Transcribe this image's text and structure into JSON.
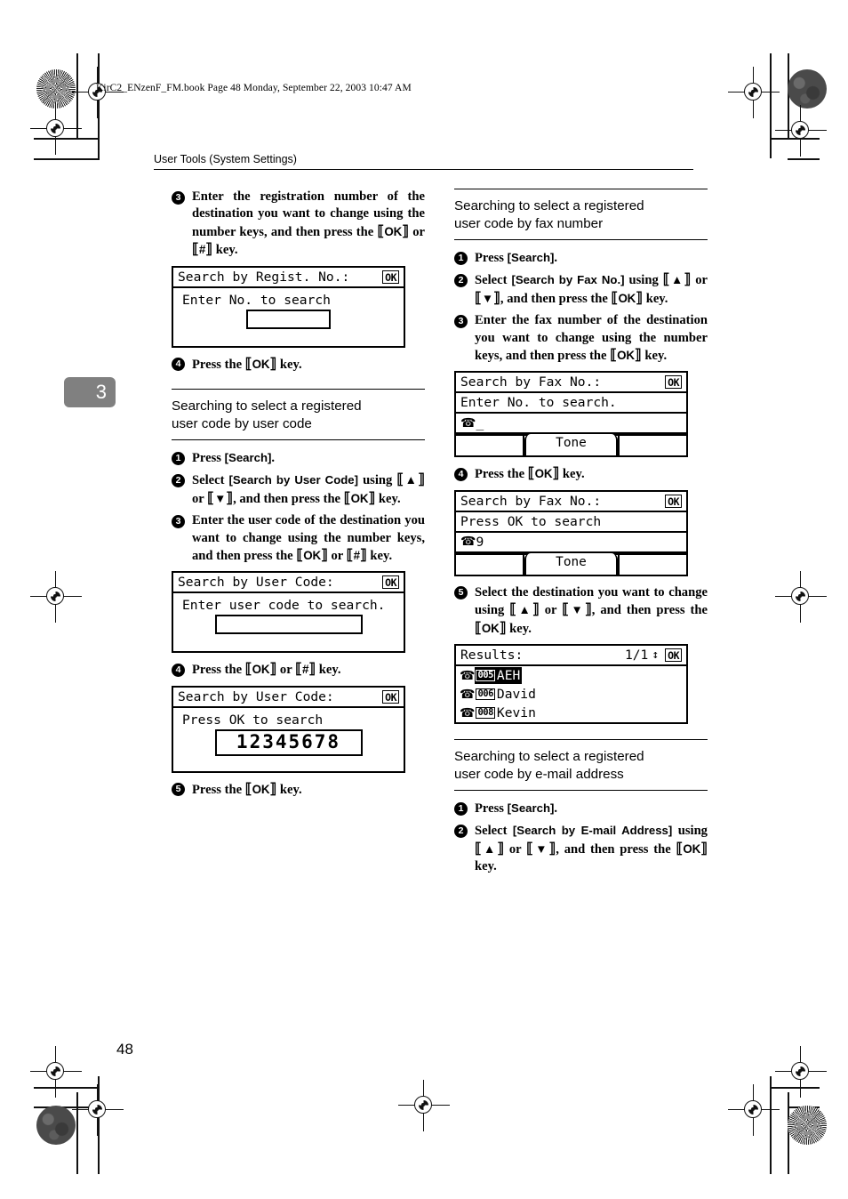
{
  "printhead": {
    "file_line": "KirC2_ENzenF_FM.book  Page 48  Monday, September 22, 2003  10:47 AM"
  },
  "running_head": "User Tools (System Settings)",
  "chapter_tab": "3",
  "page_number": "48",
  "left_column": {
    "step3": {
      "num": "3",
      "text_parts": {
        "a": "Enter the registration number of the destination you want to change using the number keys, and then press the ",
        "key1": "OK",
        "b": " or ",
        "key2": "#",
        "c": " key."
      }
    },
    "lcd_regist": {
      "title": "Search by Regist. No.:",
      "ok": "OK",
      "line1": "Enter No. to search",
      "field_value": "_ _ _ _"
    },
    "step4": {
      "num": "4",
      "a": "Press the ",
      "key1": "OK",
      "c": " key."
    },
    "section": {
      "line1": "Searching to select a registered",
      "line2": "user code by user code"
    },
    "s1": {
      "num": "1",
      "a": "Press ",
      "label": "[Search]",
      "c": "."
    },
    "s2": {
      "num": "2",
      "a": "Select ",
      "label": "[Search by User Code]",
      "b": " using ",
      "key_up": "▲",
      "mid": " or ",
      "key_dn": "▼",
      "c": ", and then press the ",
      "key_ok": "OK",
      "d": " key."
    },
    "s3": {
      "num": "3",
      "a": "Enter the user code of the destination you want to change using the number keys, and then press the ",
      "key1": "OK",
      "b": " or ",
      "key2": "#",
      "c": " key."
    },
    "lcd_usercode_entry": {
      "title": "Search by User Code:",
      "ok": "OK",
      "line1": "Enter user code to search.",
      "field_value": "_"
    },
    "s4": {
      "num": "4",
      "a": "Press the ",
      "key1": "OK",
      "b": " or ",
      "key2": "#",
      "c": " key."
    },
    "lcd_usercode_result": {
      "title": "Search by User Code:",
      "ok": "OK",
      "line1": "Press OK to search",
      "field_value": "12345678"
    },
    "s5": {
      "num": "5",
      "a": "Press the ",
      "key1": "OK",
      "c": " key."
    }
  },
  "right_column": {
    "section_fax": {
      "line1": "Searching to select a registered",
      "line2": "user code by fax number"
    },
    "f1": {
      "num": "1",
      "a": "Press ",
      "label": "[Search]",
      "c": "."
    },
    "f2": {
      "num": "2",
      "a": "Select ",
      "label": "[Search by Fax No.]",
      "b": " using ",
      "key_up": "▲",
      "mid": " or ",
      "key_dn": "▼",
      "c": ", and then press the ",
      "key_ok": "OK",
      "d": " key."
    },
    "f3": {
      "num": "3",
      "a": "Enter the fax number of the destination you want to change using the number keys, and then press the ",
      "key1": "OK",
      "c": " key."
    },
    "lcd_fax_entry": {
      "title": "Search by Fax No.:",
      "ok": "OK",
      "line1": "Enter No. to search.",
      "phone_icon": "☎",
      "field_value": "_",
      "tone": "Tone"
    },
    "f4": {
      "num": "4",
      "a": "Press the ",
      "key1": "OK",
      "c": " key."
    },
    "lcd_fax_result": {
      "title": "Search by Fax No.:",
      "ok": "OK",
      "line1": "Press OK to search",
      "phone_icon": "☎",
      "field_value": "9",
      "tone": "Tone"
    },
    "f5": {
      "num": "5",
      "a": "Select the destination you want to change using ",
      "key_up": "▲",
      "mid": " or ",
      "key_dn": "▼",
      "c": ", and then press the ",
      "key_ok": "OK",
      "d": " key."
    },
    "lcd_results": {
      "title": "Results:",
      "page_indicator": "1/1",
      "scroll_icon": "↕",
      "ok": "OK",
      "rows": [
        {
          "icon": "☎",
          "code": "005",
          "name": "AEH",
          "selected": true
        },
        {
          "icon": "☎",
          "code": "006",
          "name": "David",
          "selected": false
        },
        {
          "icon": "☎",
          "code": "008",
          "name": "Kevin",
          "selected": false
        }
      ]
    },
    "section_email": {
      "line1": "Searching to select a registered",
      "line2": "user code by e-mail address"
    },
    "e1": {
      "num": "1",
      "a": "Press ",
      "label": "[Search]",
      "c": "."
    },
    "e2": {
      "num": "2",
      "a": "Select ",
      "label": "[Search by E-mail Address]",
      "b": " using ",
      "key_up": "▲",
      "mid": " or ",
      "key_dn": "▼",
      "c": ", and then press the ",
      "key_ok": "OK",
      "d": " key."
    }
  }
}
